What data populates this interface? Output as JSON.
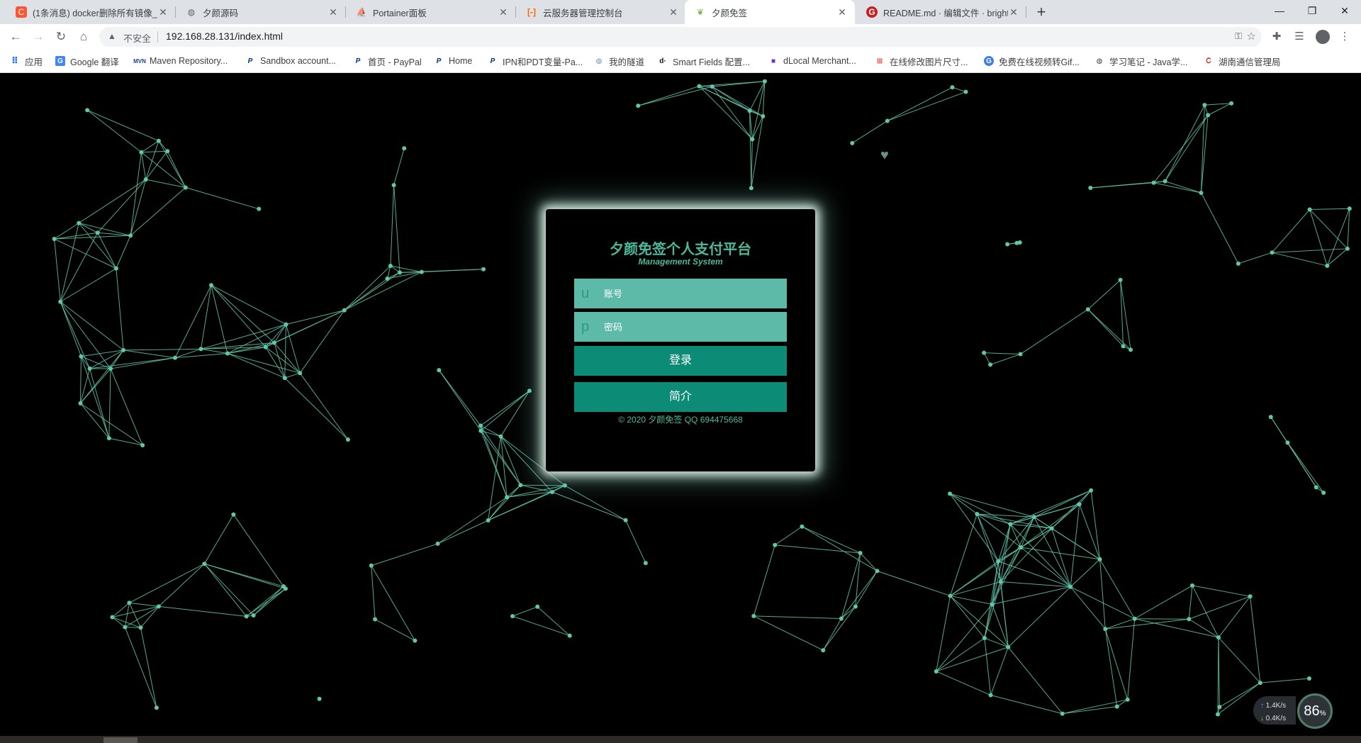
{
  "browser": {
    "tabs": [
      {
        "title": "(1条消息) docker删除所有镜像_",
        "icon": "csdn-icon",
        "color": "#fc5531",
        "active": false
      },
      {
        "title": "夕颜源码",
        "icon": "globe-icon",
        "color": "#5f6368",
        "active": false
      },
      {
        "title": "Portainer面板",
        "icon": "portainer-icon",
        "color": "#13bef9",
        "active": false
      },
      {
        "title": "云服务器管理控制台",
        "icon": "aliyun-icon",
        "color": "#ff6a00",
        "active": false
      },
      {
        "title": "夕颜免签",
        "icon": "leaf-icon",
        "color": "#7cb342",
        "active": true
      },
      {
        "title": "README.md · 编辑文件 · bright",
        "icon": "gitee-icon",
        "color": "#c71d23",
        "active": false
      }
    ],
    "new_tab": "+",
    "security_label": "不安全",
    "url": "192.168.28.131/index.html",
    "bookmarks": [
      {
        "label": "应用",
        "icon": "apps-grid-icon"
      },
      {
        "label": "Google 翻译",
        "icon": "google-translate-icon"
      },
      {
        "label": "Maven Repository...",
        "icon": "maven-icon"
      },
      {
        "label": "Sandbox account...",
        "icon": "paypal-icon"
      },
      {
        "label": "首页 - PayPal",
        "icon": "paypal-icon"
      },
      {
        "label": "Home",
        "icon": "paypal-icon"
      },
      {
        "label": "IPN和PDT变量-Pa...",
        "icon": "paypal-icon"
      },
      {
        "label": "我的隧道",
        "icon": "globe-icon"
      },
      {
        "label": "Smart Fields 配置...",
        "icon": "dlocal-icon"
      },
      {
        "label": "dLocal Merchant...",
        "icon": "dlocal-merchant-icon"
      },
      {
        "label": "在线修改图片尺寸...",
        "icon": "resize-icon"
      },
      {
        "label": "免费在线视频转Gif...",
        "icon": "video-gif-icon"
      },
      {
        "label": "学习笔记 - Java学...",
        "icon": "notes-icon"
      },
      {
        "label": "湖南通信管理局",
        "icon": "telecom-icon"
      }
    ]
  },
  "login": {
    "title": "夕颜免签个人支付平台",
    "subtitle": "Management System",
    "username_prefix": "u",
    "username_placeholder": "账号",
    "password_prefix": "p",
    "password_placeholder": "密码",
    "login_button": "登录",
    "intro_button": "简介",
    "copyright": "© 2020 夕颜免签 QQ 694475668"
  },
  "net_monitor": {
    "upload": "1.4K/s",
    "download": "0.4K/s",
    "percent": "86",
    "percent_unit": "%"
  },
  "colors": {
    "accent": "#4bb99c",
    "input_bg": "#5dbaa8",
    "button_bg": "#0c8c77",
    "particle": "#62c6ad"
  }
}
